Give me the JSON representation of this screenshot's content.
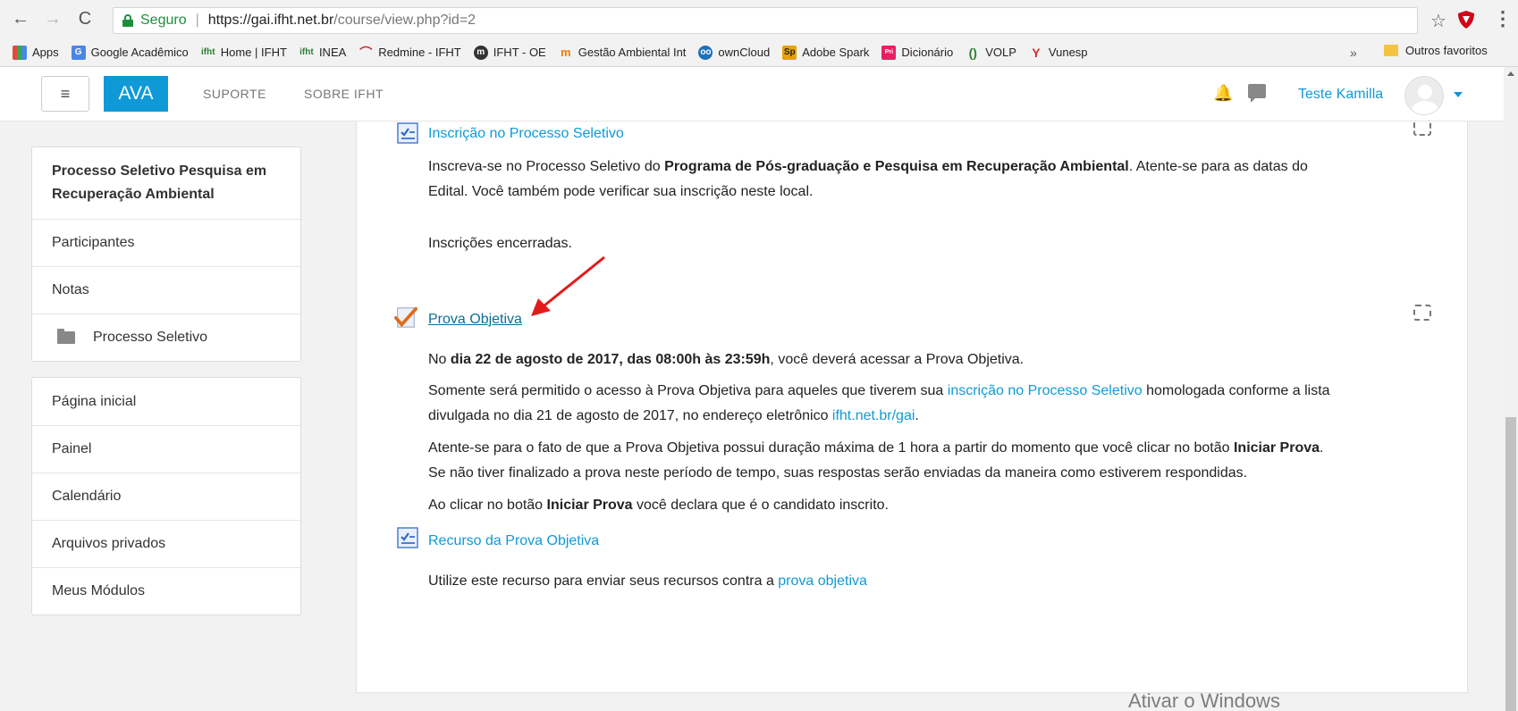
{
  "browser": {
    "secure_label": "Seguro",
    "url_domain": "https://gai.ifht.net.br",
    "url_path": "/course/view.php?id=2",
    "bookmarks": [
      {
        "label": "Apps",
        "icon": "apps-grid-icon",
        "color": "#e04c3c"
      },
      {
        "label": "Google Acadêmico",
        "icon": "scholar-icon",
        "color": "#4a86e8"
      },
      {
        "label": "Home | IFHT",
        "icon": "ifht-icon",
        "color": "#2e7d32"
      },
      {
        "label": "INEA",
        "icon": "ifht-icon",
        "color": "#2e7d32"
      },
      {
        "label": "Redmine - IFHT",
        "icon": "redmine-icon",
        "color": "#c62828"
      },
      {
        "label": "IFHT - OE",
        "icon": "moodle-icon",
        "color": "#333333"
      },
      {
        "label": "Gestão Ambiental Int",
        "icon": "moodle-icon",
        "color": "#f57c00"
      },
      {
        "label": "ownCloud",
        "icon": "owncloud-icon",
        "color": "#1d6fb8"
      },
      {
        "label": "Adobe Spark",
        "icon": "spark-icon",
        "color": "#e8a200"
      },
      {
        "label": "Dicionário",
        "icon": "dictionary-icon",
        "color": "#e91e63"
      },
      {
        "label": "VOLP",
        "icon": "volp-icon",
        "color": "#2e7d32"
      },
      {
        "label": "Vunesp",
        "icon": "vunesp-icon",
        "color": "#d32f2f"
      }
    ],
    "more": "»",
    "other_bookmarks": "Outros favoritos"
  },
  "navbar": {
    "menu_glyph": "≡",
    "brand": "AVA",
    "links": [
      "SUPORTE",
      "SOBRE IFHT"
    ],
    "user": "Teste Kamilla"
  },
  "sidebar": {
    "course_title": "Processo Seletivo Pesquisa em Recuperação Ambiental",
    "course_items": [
      "Participantes",
      "Notas",
      "Processo Seletivo"
    ],
    "nav_items": [
      "Página inicial",
      "Painel",
      "Calendário",
      "Arquivos privados",
      "Meus Módulos"
    ]
  },
  "main": {
    "activity1": {
      "title": "Inscrição no Processo Seletivo",
      "desc_pre": "Inscreva-se no Processo Seletivo do ",
      "desc_bold": "Programa de Pós-graduação e Pesquisa em Recuperação Ambiental",
      "desc_post": ". Atente-se para as datas do",
      "desc_line2": "Edital. Você também pode verificar sua inscrição neste local.",
      "status": "Inscrições encerradas."
    },
    "activity2": {
      "title": "Prova Objetiva",
      "p1_pre": "No ",
      "p1_bold": "dia 22 de agosto de 2017, das 08:00h às 23:59h",
      "p1_post": ", você deverá acessar a Prova Objetiva.",
      "p2_pre": "Somente será permitido o acesso à Prova Objetiva para aqueles que tiverem sua ",
      "p2_link": "inscrição no Processo Seletivo",
      "p2_post": " homologada conforme a lista",
      "p2_line2_pre": "divulgada no dia 21 de agosto de 2017, no endereço eletrônico ",
      "p2_link2": "ifht.net.br/gai",
      "p2_line2_post": ".",
      "p3_pre": "Atente-se para o fato de que a Prova Objetiva possui duração máxima de 1 hora a partir do momento que você clicar no botão ",
      "p3_bold": "Iniciar Prova",
      "p3_post": ".",
      "p3_line2": "Se não tiver finalizado a prova neste período de tempo, suas respostas serão enviadas da maneira como estiverem respondidas.",
      "p4_pre": "Ao clicar no botão ",
      "p4_bold": "Iniciar Prova",
      "p4_post": " você declara que é o candidato inscrito."
    },
    "activity3": {
      "title": "Recurso da Prova Objetiva",
      "desc_pre": "Utilize este recurso para enviar seus recursos contra a ",
      "desc_link": "prova objetiva"
    }
  },
  "watermark": "Ativar o Windows",
  "colors": {
    "accent": "#0f9ad7",
    "annotation_arrow": "#e31b1b"
  }
}
